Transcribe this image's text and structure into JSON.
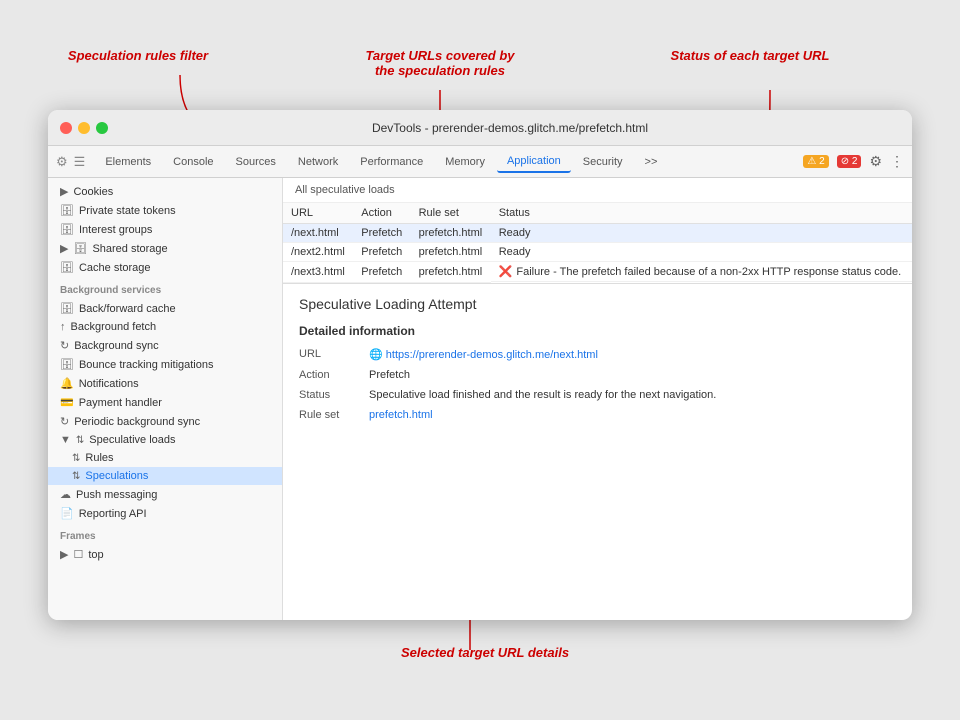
{
  "annotations": {
    "speculation_filter": "Speculation rules filter",
    "target_urls": "Target URLs covered by\nthe speculation rules",
    "status_each": "Status of each target URL",
    "selected_details": "Selected target URL details"
  },
  "window": {
    "title": "DevTools - prerender-demos.glitch.me/prefetch.html",
    "traffic_lights": [
      "red",
      "yellow",
      "green"
    ]
  },
  "toolbar": {
    "tabs": [
      {
        "label": "Elements",
        "active": false
      },
      {
        "label": "Console",
        "active": false
      },
      {
        "label": "Sources",
        "active": false
      },
      {
        "label": "Network",
        "active": false
      },
      {
        "label": "Performance",
        "active": false
      },
      {
        "label": "Memory",
        "active": false
      },
      {
        "label": "Application",
        "active": true
      },
      {
        "label": "Security",
        "active": false
      },
      {
        "label": ">>",
        "active": false
      }
    ],
    "warn_count": "2",
    "err_count": "2"
  },
  "sidebar": {
    "sections": {
      "storage": {
        "items": [
          {
            "label": "Cookies",
            "icon": "🍪",
            "indent": 0
          },
          {
            "label": "Private state tokens",
            "icon": "🗄",
            "indent": 0
          },
          {
            "label": "Interest groups",
            "icon": "🗄",
            "indent": 0
          },
          {
            "label": "Shared storage",
            "icon": "🗄",
            "indent": 0
          },
          {
            "label": "Cache storage",
            "icon": "🗄",
            "indent": 0
          }
        ]
      },
      "background_services": {
        "label": "Background services",
        "items": [
          {
            "label": "Back/forward cache",
            "icon": "🗄",
            "indent": 0
          },
          {
            "label": "Background fetch",
            "icon": "↑",
            "indent": 0
          },
          {
            "label": "Background sync",
            "icon": "↻",
            "indent": 0
          },
          {
            "label": "Bounce tracking mitigations",
            "icon": "🗄",
            "indent": 0
          },
          {
            "label": "Notifications",
            "icon": "🔔",
            "indent": 0
          },
          {
            "label": "Payment handler",
            "icon": "💳",
            "indent": 0
          },
          {
            "label": "Periodic background sync",
            "icon": "↻",
            "indent": 0
          },
          {
            "label": "Speculative loads",
            "icon": "↑↓",
            "indent": 0,
            "expanded": true
          },
          {
            "label": "Rules",
            "icon": "↑↓",
            "indent": 1
          },
          {
            "label": "Speculations",
            "icon": "↑↓",
            "indent": 1,
            "active": true
          },
          {
            "label": "Push messaging",
            "icon": "☁",
            "indent": 0
          },
          {
            "label": "Reporting API",
            "icon": "📄",
            "indent": 0
          }
        ]
      },
      "frames": {
        "label": "Frames",
        "items": [
          {
            "label": "top",
            "icon": "▶",
            "indent": 0
          }
        ]
      }
    }
  },
  "speculative_loads": {
    "header": "All speculative loads",
    "columns": [
      "URL",
      "Action",
      "Rule set",
      "Status"
    ],
    "rows": [
      {
        "url": "/next.html",
        "action": "Prefetch",
        "rule_set": "prefetch.html",
        "status": "Ready",
        "type": "ready"
      },
      {
        "url": "/next2.html",
        "action": "Prefetch",
        "rule_set": "prefetch.html",
        "status": "Ready",
        "type": "ready"
      },
      {
        "url": "/next3.html",
        "action": "Prefetch",
        "rule_set": "prefetch.html",
        "status": "Failure - The prefetch failed because of a non-2xx HTTP response status code.",
        "type": "error"
      }
    ]
  },
  "detail_panel": {
    "title": "Speculative Loading Attempt",
    "subtitle": "Detailed information",
    "fields": {
      "url_label": "URL",
      "url_value": "https://prerender-demos.glitch.me/next.html",
      "action_label": "Action",
      "action_value": "Prefetch",
      "status_label": "Status",
      "status_value": "Speculative load finished and the result is ready for the next navigation.",
      "rule_set_label": "Rule set",
      "rule_set_value": "prefetch.html"
    }
  }
}
